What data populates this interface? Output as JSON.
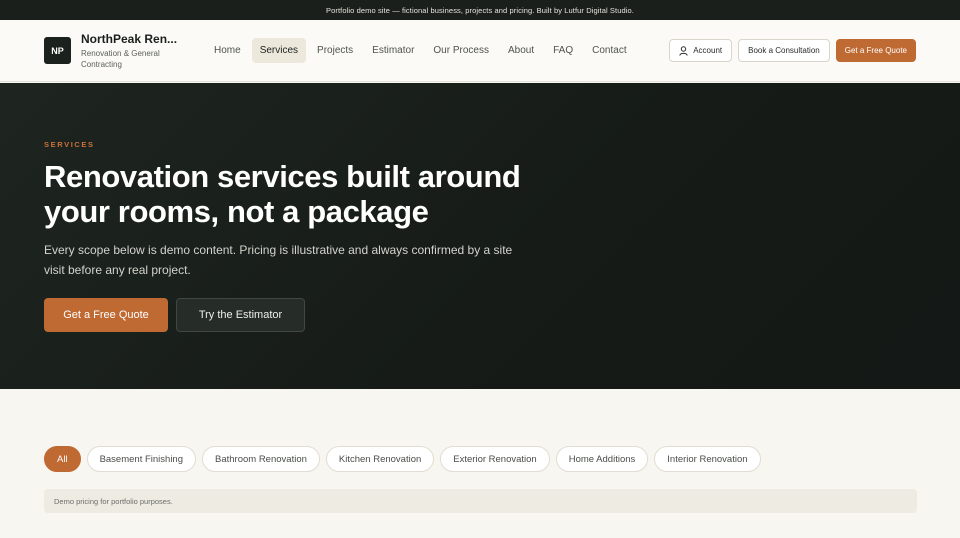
{
  "banner": {
    "text": "Portfolio demo site — fictional business, projects and pricing. Built by Lutfur Digital Studio."
  },
  "brand": {
    "initials": "NP",
    "name": "NorthPeak Ren...",
    "tagline": "Renovation & General Contracting"
  },
  "nav": {
    "links": [
      "Home",
      "Services",
      "Projects",
      "Estimator",
      "Our Process",
      "About",
      "FAQ",
      "Contact"
    ],
    "active": "Services"
  },
  "actions": {
    "account": "Account",
    "consultation": "Book a Consultation",
    "quote": "Get a Free Quote"
  },
  "hero": {
    "eyebrow": "SERVICES",
    "title": "Renovation services built around your rooms, not a package",
    "description": "Every scope below is demo content. Pricing is illustrative and always confirmed by a site visit before any real project.",
    "primary_cta": "Get a Free Quote",
    "secondary_cta": "Try the Estimator"
  },
  "filters": {
    "items": [
      "All",
      "Basement Finishing",
      "Bathroom Renovation",
      "Kitchen Renovation",
      "Exterior Renovation",
      "Home Additions",
      "Interior Renovation"
    ],
    "active": "All"
  },
  "note": {
    "text": "Demo pricing for portfolio purposes."
  },
  "colors": {
    "accent": "#c06a33",
    "hero_bg": "#1a201c",
    "page_bg": "#f8f6f1"
  },
  "icons": {
    "account": "user-icon"
  }
}
